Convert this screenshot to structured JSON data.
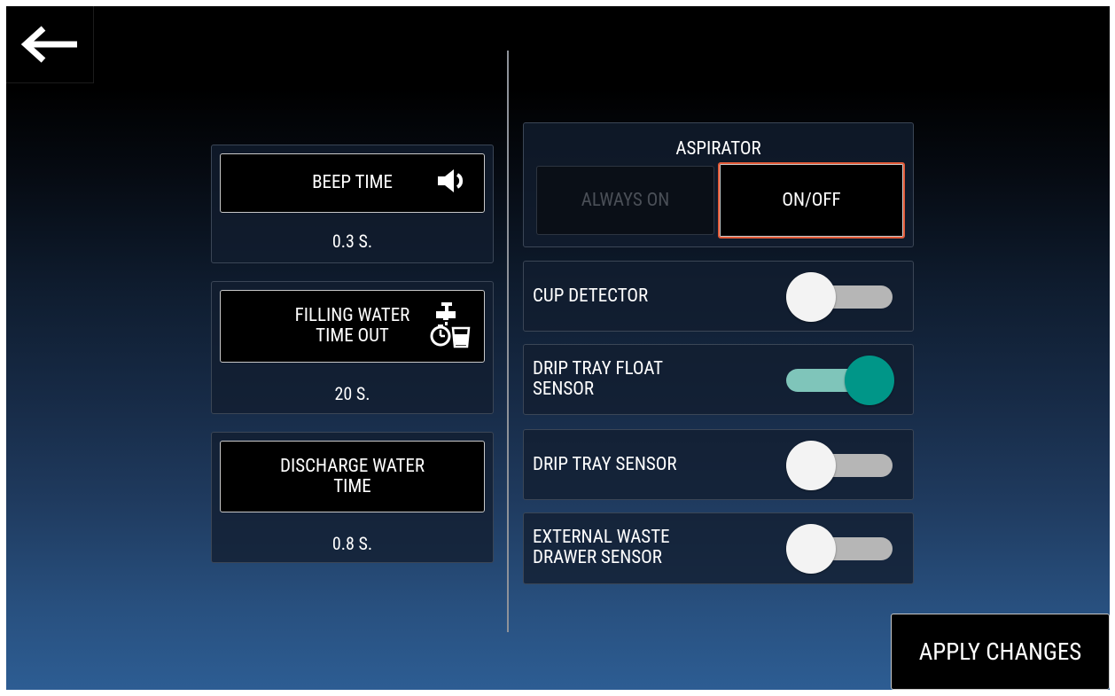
{
  "left": {
    "beep": {
      "label": "BEEP TIME",
      "value": "0.3 S.",
      "icon": "speaker-icon"
    },
    "filling": {
      "label_line1": "FILLING WATER",
      "label_line2": "TIME OUT",
      "value": "20 S.",
      "icon": "tap-timer-cup-icon"
    },
    "discharge": {
      "label_line1": "DISCHARGE WATER",
      "label_line2": "TIME",
      "value": "0.8 S."
    }
  },
  "aspirator": {
    "title": "ASPIRATOR",
    "options": [
      "ALWAYS ON",
      "ON/OFF"
    ],
    "selected": "ON/OFF"
  },
  "toggles": [
    {
      "line1": "CUP DETECTOR",
      "line2": "",
      "on": false
    },
    {
      "line1": "DRIP TRAY FLOAT",
      "line2": "SENSOR",
      "on": true
    },
    {
      "line1": "DRIP TRAY SENSOR",
      "line2": "",
      "on": false
    },
    {
      "line1": "EXTERNAL WASTE",
      "line2": "DRAWER SENSOR",
      "on": false
    }
  ],
  "apply_label": "APPLY CHANGES",
  "colors": {
    "accent_selected": "#e25a38",
    "toggle_on": "#009688",
    "toggle_on_track": "#7fc5ba"
  }
}
